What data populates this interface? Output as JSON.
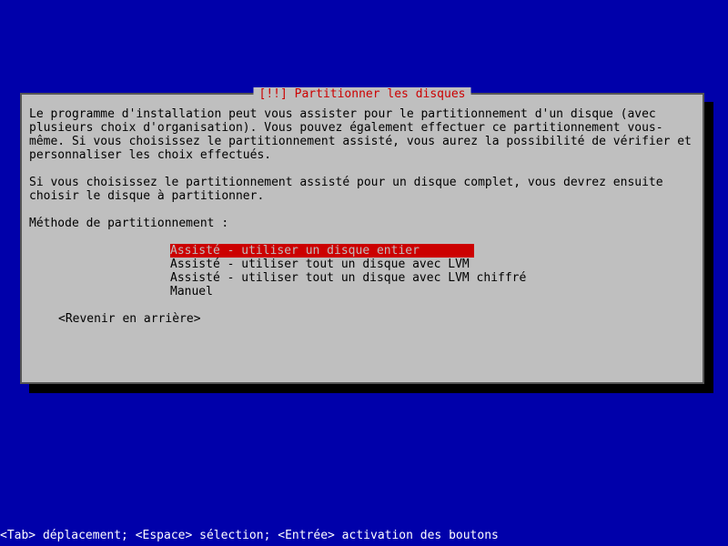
{
  "dialog": {
    "title": "[!!] Partitionner les disques",
    "paragraph1": "Le programme d'installation peut vous assister pour le partitionnement d'un disque (avec plusieurs choix d'organisation). Vous pouvez également effectuer ce partitionnement vous-même. Si vous choisissez le partitionnement assisté, vous aurez la possibilité de vérifier et personnaliser les choix effectués.",
    "paragraph2": "Si vous choisissez le partitionnement assisté pour un disque complet, vous devrez ensuite choisir le disque à partitionner.",
    "prompt": "Méthode de partitionnement :",
    "menu": [
      "Assisté - utiliser un disque entier",
      "Assisté - utiliser tout un disque avec LVM",
      "Assisté - utiliser tout un disque avec LVM chiffré",
      "Manuel"
    ],
    "back": "<Revenir en arrière>"
  },
  "footer": "<Tab> déplacement; <Espace> sélection; <Entrée> activation des boutons"
}
